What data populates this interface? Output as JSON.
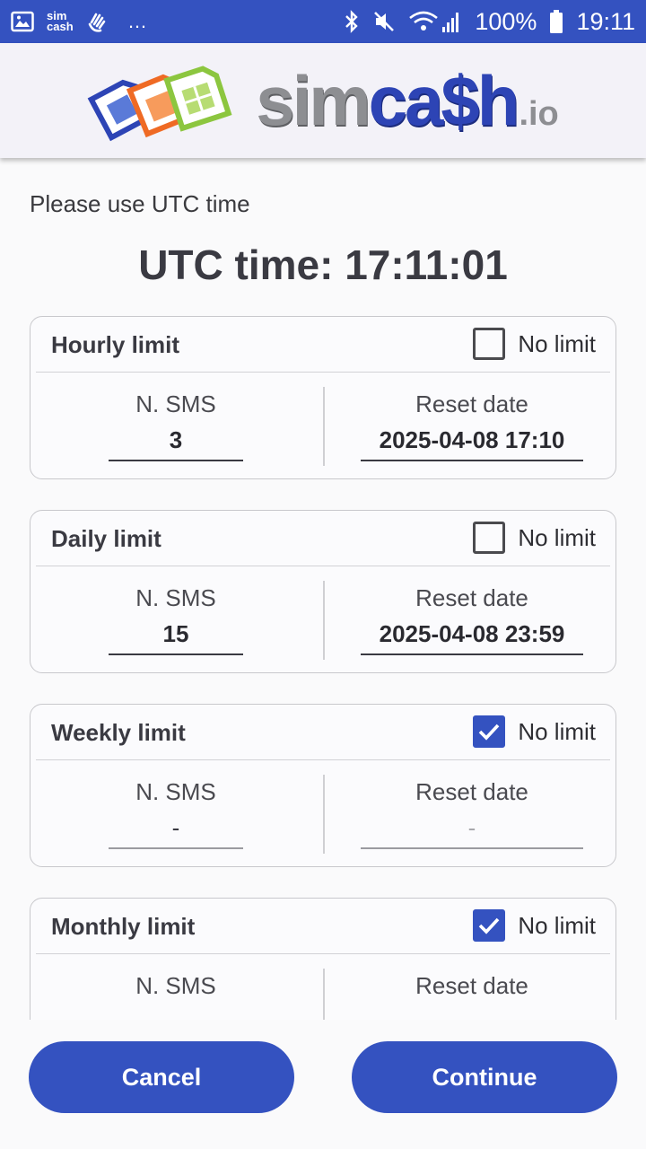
{
  "status_bar": {
    "app_badge": "sim cash",
    "more": "…",
    "battery_text": "100%",
    "time": "19:11"
  },
  "header": {
    "logo_sim": "sim",
    "logo_cash": "ca$h",
    "logo_io": ".io"
  },
  "hint": "Please use UTC time",
  "utc_time": "UTC time: 17:11:01",
  "limits": [
    {
      "title": "Hourly limit",
      "no_limit_label": "No limit",
      "no_limit_checked": false,
      "sms_label": "N. SMS",
      "sms_value": "3",
      "date_label": "Reset date",
      "date_value": "2025-04-08 17:10"
    },
    {
      "title": "Daily limit",
      "no_limit_label": "No limit",
      "no_limit_checked": false,
      "sms_label": "N. SMS",
      "sms_value": "15",
      "date_label": "Reset date",
      "date_value": "2025-04-08 23:59"
    },
    {
      "title": "Weekly limit",
      "no_limit_label": "No limit",
      "no_limit_checked": true,
      "sms_label": "N. SMS",
      "sms_value": "-",
      "date_label": "Reset date",
      "date_value": "-"
    },
    {
      "title": "Monthly limit",
      "no_limit_label": "No limit",
      "no_limit_checked": true,
      "sms_label": "N. SMS",
      "sms_value": "-",
      "date_label": "Reset date",
      "date_value": "-"
    }
  ],
  "buttons": {
    "cancel": "Cancel",
    "continue": "Continue"
  },
  "colors": {
    "primary": "#3452c0",
    "logo_grey": "#8d8e92",
    "logo_blue": "#2d44b5"
  }
}
